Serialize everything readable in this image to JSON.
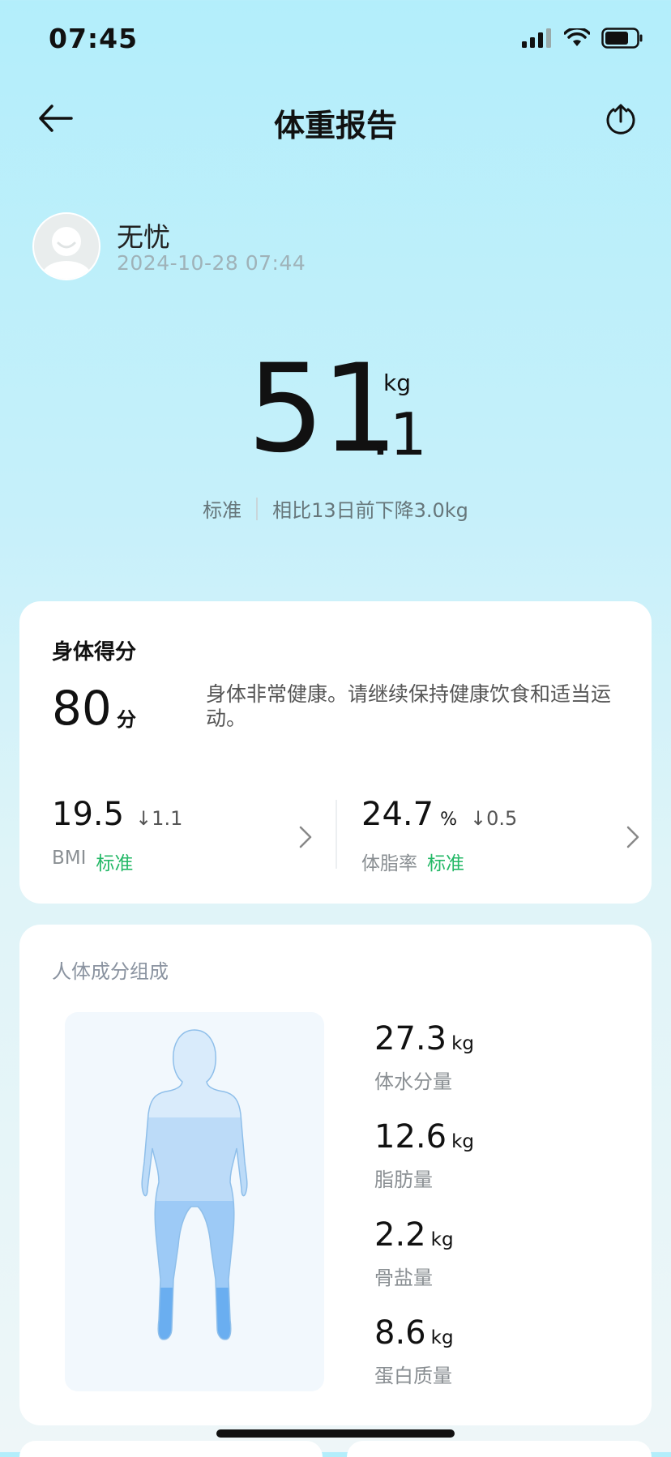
{
  "status_bar": {
    "time": "07:45"
  },
  "header": {
    "title": "体重报告"
  },
  "profile": {
    "name": "无忧",
    "datetime": "2024-10-28 07:44"
  },
  "weight": {
    "integer": "51",
    "decimal": ".1",
    "unit": "kg",
    "status": "标准",
    "change_text": "相比13日前下降3.0kg"
  },
  "score_card": {
    "title": "身体得分",
    "score": "80",
    "score_unit": "分",
    "description": "身体非常健康。请继续保持健康饮食和适当运动。",
    "bmi": {
      "value": "19.5",
      "delta": "↓1.1",
      "label": "BMI",
      "status": "标准"
    },
    "body_fat": {
      "value": "24.7",
      "unit": "%",
      "delta": "↓0.5",
      "label": "体脂率",
      "status": "标准"
    }
  },
  "composition": {
    "title": "人体成分组成",
    "items": [
      {
        "value": "27.3",
        "unit": "kg",
        "label": "体水分量"
      },
      {
        "value": "12.6",
        "unit": "kg",
        "label": "脂肪量"
      },
      {
        "value": "2.2",
        "unit": "kg",
        "label": "骨盐量"
      },
      {
        "value": "8.6",
        "unit": "kg",
        "label": "蛋白质量"
      }
    ]
  },
  "colors": {
    "status_green": "#23b866",
    "bg_top": "#b3eefb"
  }
}
